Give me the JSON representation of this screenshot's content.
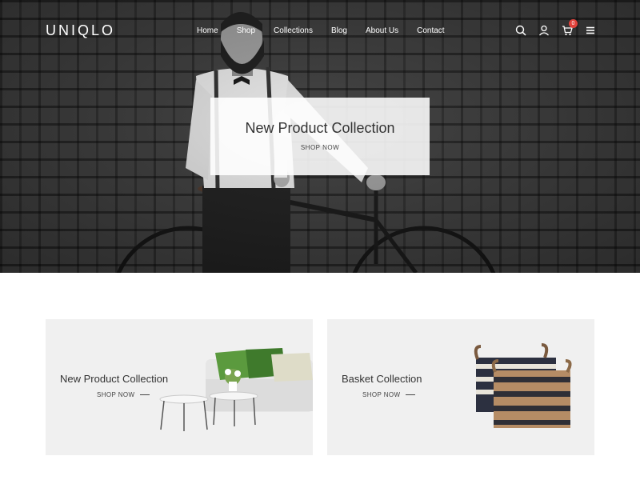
{
  "header": {
    "logo": "UNIQLO",
    "nav": [
      "Home",
      "Shop",
      "Collections",
      "Blog",
      "About Us",
      "Contact"
    ],
    "icons": [
      "search-icon",
      "user-icon",
      "cart-icon",
      "menu-icon"
    ],
    "cart_count": "0"
  },
  "hero": {
    "title": "New Product Collection",
    "link": "SHOP NOW"
  },
  "banners": [
    {
      "title": "New Product Collection",
      "link": "SHOP NOW"
    },
    {
      "title": "Basket Collection",
      "link": "SHOP NOW"
    }
  ],
  "colors": {
    "badge": "#e0423b",
    "banner_bg": "#f0f0f0",
    "text": "#333333"
  }
}
